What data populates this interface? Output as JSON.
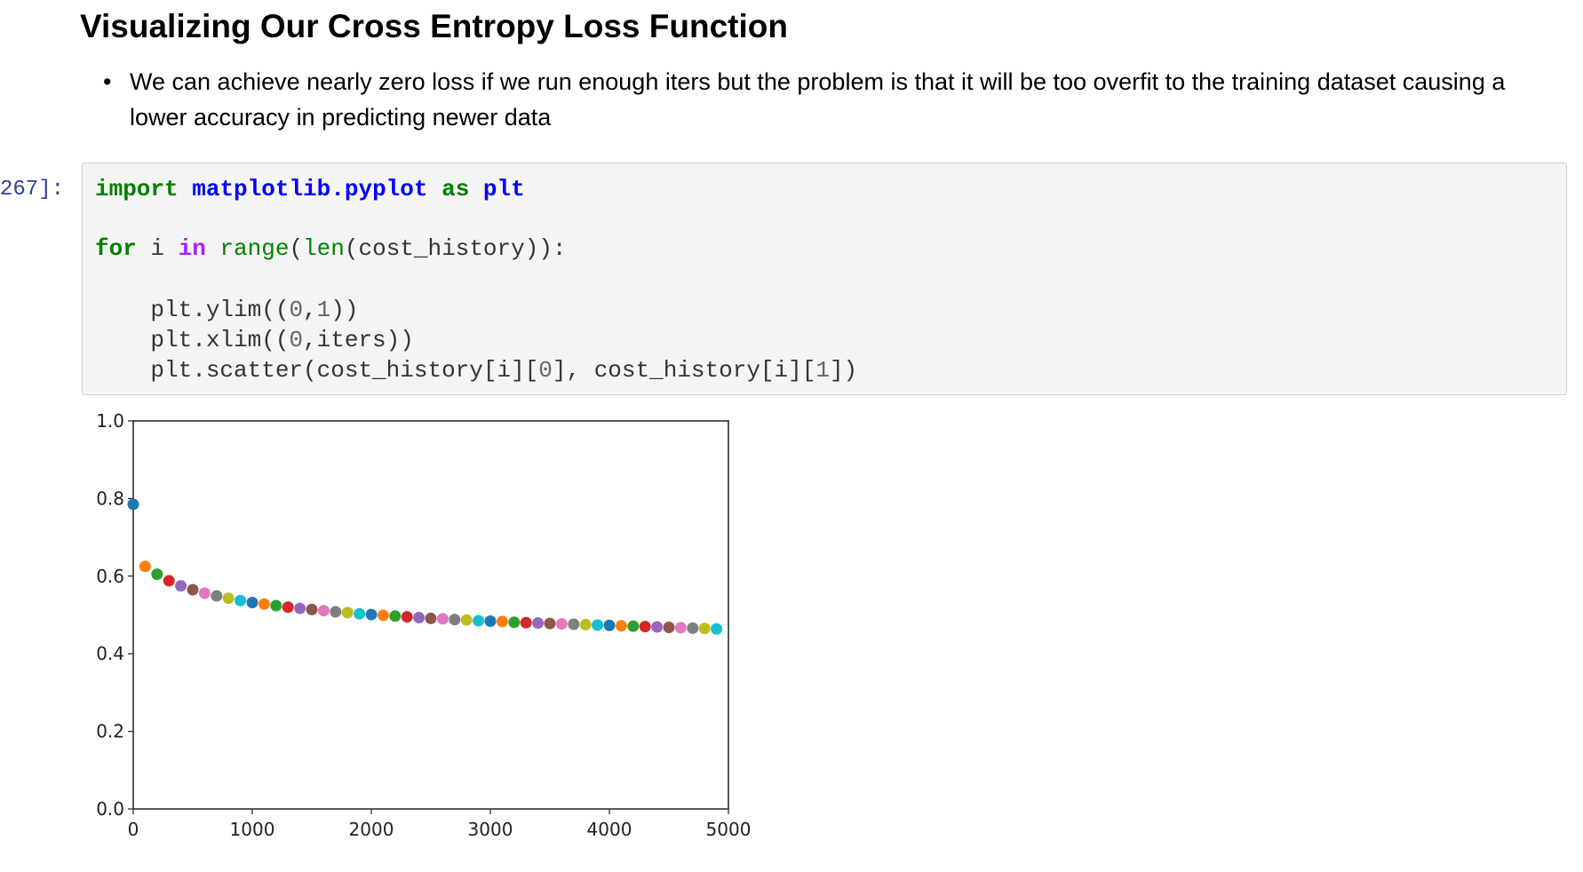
{
  "markdown": {
    "heading": "Visualizing Our Cross Entropy Loss Function",
    "bullets": [
      "We can achieve nearly zero loss if we run enough iters but the problem is that it will be too overfit to the training dataset causing a lower accuracy in predicting newer data"
    ]
  },
  "code_cell": {
    "prompt": "267]:",
    "lines": [
      [
        {
          "t": "import",
          "c": "kw"
        },
        {
          "t": " ",
          "c": "p"
        },
        {
          "t": "matplotlib.pyplot",
          "c": "mod"
        },
        {
          "t": " ",
          "c": "p"
        },
        {
          "t": "as",
          "c": "kw"
        },
        {
          "t": " ",
          "c": "p"
        },
        {
          "t": "plt",
          "c": "mod"
        }
      ],
      [],
      [
        {
          "t": "for",
          "c": "kw"
        },
        {
          "t": " i ",
          "c": "p"
        },
        {
          "t": "in",
          "c": "op"
        },
        {
          "t": " ",
          "c": "p"
        },
        {
          "t": "range",
          "c": "bi"
        },
        {
          "t": "(",
          "c": "p"
        },
        {
          "t": "len",
          "c": "bi"
        },
        {
          "t": "(cost_history)):",
          "c": "p"
        }
      ],
      [],
      [
        {
          "t": "    plt.ylim((",
          "c": "p"
        },
        {
          "t": "0",
          "c": "num"
        },
        {
          "t": ",",
          "c": "p"
        },
        {
          "t": "1",
          "c": "num"
        },
        {
          "t": "))",
          "c": "p"
        }
      ],
      [
        {
          "t": "    plt.xlim((",
          "c": "p"
        },
        {
          "t": "0",
          "c": "num"
        },
        {
          "t": ",iters))",
          "c": "p"
        }
      ],
      [
        {
          "t": "    plt.scatter(cost_history[i][",
          "c": "p"
        },
        {
          "t": "0",
          "c": "num"
        },
        {
          "t": "], cost_history[i][",
          "c": "p"
        },
        {
          "t": "1",
          "c": "num"
        },
        {
          "t": "])",
          "c": "p"
        }
      ]
    ]
  },
  "chart_data": {
    "type": "scatter",
    "title": "",
    "xlabel": "",
    "ylabel": "",
    "xlim": [
      0,
      5000
    ],
    "ylim": [
      0,
      1
    ],
    "xticks": [
      0,
      1000,
      2000,
      3000,
      4000,
      5000
    ],
    "yticks": [
      0.0,
      0.2,
      0.4,
      0.6,
      0.8,
      1.0
    ],
    "xtick_labels": [
      "0",
      "1000",
      "2000",
      "3000",
      "4000",
      "5000"
    ],
    "ytick_labels": [
      "0.0",
      "0.2",
      "0.4",
      "0.6",
      "0.8",
      "1.0"
    ],
    "grid": false,
    "color_cycle": [
      "#1f77b4",
      "#ff7f0e",
      "#2ca02c",
      "#d62728",
      "#9467bd",
      "#8c564b",
      "#e377c2",
      "#7f7f7f",
      "#bcbd22",
      "#17becf"
    ],
    "x": [
      0,
      100,
      200,
      300,
      400,
      500,
      600,
      700,
      800,
      900,
      1000,
      1100,
      1200,
      1300,
      1400,
      1500,
      1600,
      1700,
      1800,
      1900,
      2000,
      2100,
      2200,
      2300,
      2400,
      2500,
      2600,
      2700,
      2800,
      2900,
      3000,
      3100,
      3200,
      3300,
      3400,
      3500,
      3600,
      3700,
      3800,
      3900,
      4000,
      4100,
      4200,
      4300,
      4400,
      4500,
      4600,
      4700,
      4800,
      4900
    ],
    "y": [
      0.785,
      0.625,
      0.605,
      0.588,
      0.575,
      0.565,
      0.556,
      0.549,
      0.543,
      0.537,
      0.532,
      0.528,
      0.524,
      0.52,
      0.517,
      0.514,
      0.511,
      0.508,
      0.506,
      0.503,
      0.501,
      0.499,
      0.497,
      0.495,
      0.493,
      0.491,
      0.49,
      0.488,
      0.487,
      0.485,
      0.484,
      0.483,
      0.481,
      0.48,
      0.479,
      0.478,
      0.477,
      0.476,
      0.475,
      0.474,
      0.473,
      0.472,
      0.471,
      0.47,
      0.469,
      0.468,
      0.467,
      0.466,
      0.465,
      0.464
    ]
  }
}
